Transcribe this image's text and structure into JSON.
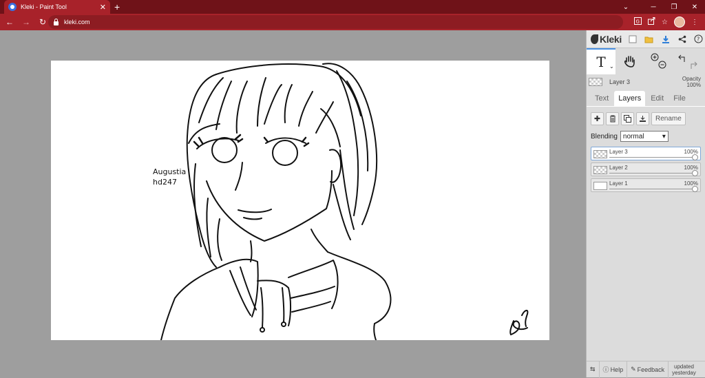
{
  "browser": {
    "tab_title": "Kleki - Paint Tool",
    "tab_close": "✕",
    "new_tab": "+",
    "url": "kleki.com",
    "back": "←",
    "forward": "→",
    "reload": "↻",
    "win_chevron": "⌄",
    "win_min": "─",
    "win_restore": "❐",
    "win_close": "✕"
  },
  "canvas": {
    "text_lines": [
      "Augustia",
      "hd247"
    ]
  },
  "panel": {
    "logo": "Kleki",
    "current_layer": "Layer 3",
    "opacity_label": "Opacity",
    "opacity_value": "100%",
    "tabs": [
      {
        "label": "Text"
      },
      {
        "label": "Layers"
      },
      {
        "label": "Edit"
      },
      {
        "label": "File"
      }
    ],
    "rename_label": "Rename",
    "blending_label": "Blending",
    "blending_value": "normal",
    "layers": [
      {
        "name": "Layer 3",
        "opacity": "100%"
      },
      {
        "name": "Layer 2",
        "opacity": "100%"
      },
      {
        "name": "Layer 1",
        "opacity": "100%"
      }
    ],
    "footer": {
      "help": "Help",
      "feedback": "Feedback",
      "updated_line1": "updated",
      "updated_line2": "yesterday"
    }
  },
  "colors": {
    "browser_accent": "#a8222a",
    "tab_strip": "#6f1218",
    "workspace": "#9e9e9e",
    "panel": "#dcdcdc",
    "selection": "#4a90e2"
  }
}
